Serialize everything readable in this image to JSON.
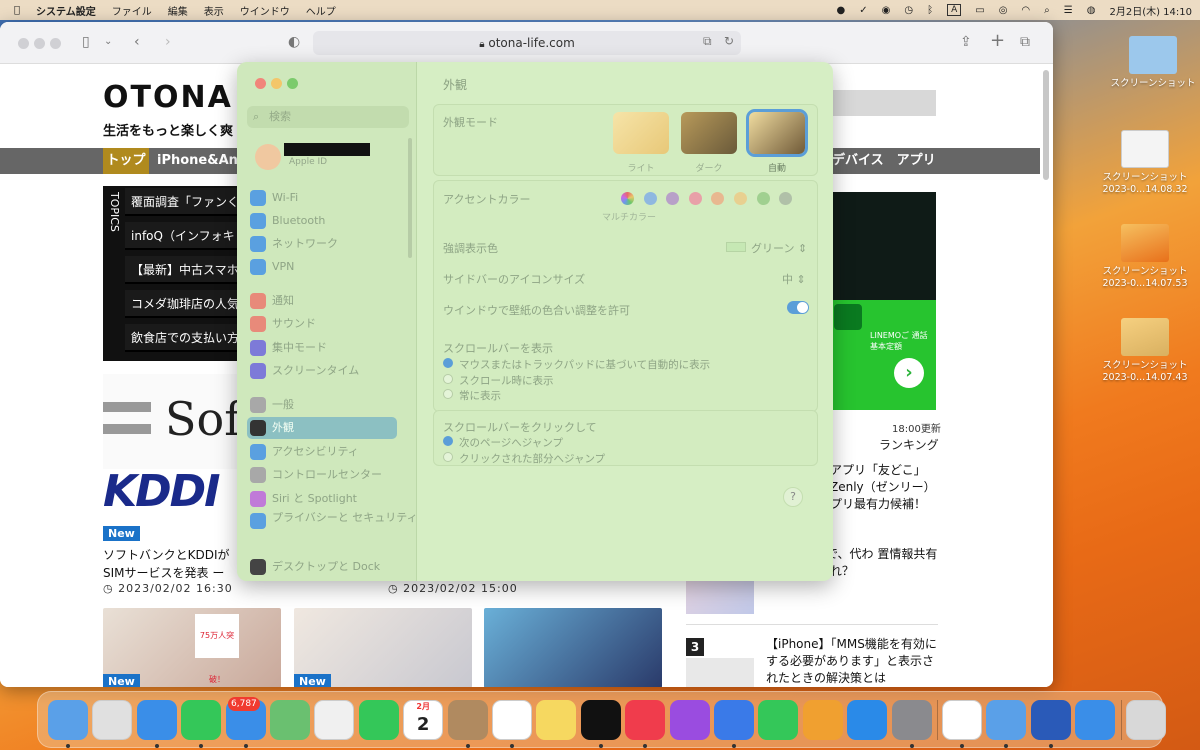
{
  "menubar": {
    "app": "システム設定",
    "items": [
      "ファイル",
      "編集",
      "表示",
      "ウインドウ",
      "ヘルプ"
    ],
    "input_indicator": "A",
    "datetime": "2月2日(木) 14:10"
  },
  "browser": {
    "url": "otona-life.com",
    "page": {
      "logo": "OTONA L",
      "tagline": "生活をもっと楽しく爽",
      "nav_top": "トップ",
      "nav_iphone": "iPhone&And",
      "nav_right": "デバイス　アプリ",
      "topics_label": "TOPICS",
      "topics": [
        "覆面調査「ファンく",
        "infoQ（インフォキ",
        "【最新】中古スマホ",
        "コメダ珈琲店の人気",
        "飲食店での支払い方"
      ],
      "soft_text": "Sof",
      "kddi_text": "KDDI",
      "new_label": "New",
      "article_title": "ソフトバンクとKDDIが SIMサービスを発表 ー",
      "date1": "2023/02/02 16:30",
      "date2": "2023/02/02 15:00",
      "ad_text": "LINEMOご 通話基本定額",
      "update_time": "18:00更新",
      "ranking": "ランキング",
      "rank_items": [
        "アプリ「友どこ」 Zenly（ゼンリー） プリ最有力候補！",
        "リー）終了で、代わ 置情報共有アプリ はどれ？",
        "【iPhone】「MMS機能を有効に する必要があります」と表示さ れたときの解決策とは"
      ],
      "rank_number": "3",
      "thumb_text": "75万人突破！"
    }
  },
  "desktop": {
    "icons": [
      {
        "label": "スクリーンショット"
      },
      {
        "label": "スクリーンショット 2023-0...14.08.32"
      },
      {
        "label": "スクリーンショット 2023-0...14.07.53"
      },
      {
        "label": "スクリーンショット 2023-0...14.07.43"
      }
    ]
  },
  "settings": {
    "search_placeholder": "検索",
    "appleid": "Apple ID",
    "sidebar": [
      {
        "label": "Wi-Fi",
        "icon": "wifi-icon",
        "color": "#5aa0e0"
      },
      {
        "label": "Bluetooth",
        "icon": "bluetooth-icon",
        "color": "#5aa0e0"
      },
      {
        "label": "ネットワーク",
        "icon": "globe-icon",
        "color": "#5aa0e0"
      },
      {
        "label": "VPN",
        "icon": "vpn-icon",
        "color": "#5aa0e0"
      },
      {
        "label": "通知",
        "icon": "bell-icon",
        "color": "#e88a7a"
      },
      {
        "label": "サウンド",
        "icon": "speaker-icon",
        "color": "#e88a7a"
      },
      {
        "label": "集中モード",
        "icon": "moon-icon",
        "color": "#7d7ad8"
      },
      {
        "label": "スクリーンタイム",
        "icon": "hourglass-icon",
        "color": "#7d7ad8"
      },
      {
        "label": "一般",
        "icon": "gear-icon",
        "color": "#a8a8a8"
      },
      {
        "label": "外観",
        "icon": "appearance-icon",
        "color": "#333333"
      },
      {
        "label": "アクセシビリティ",
        "icon": "accessibility-icon",
        "color": "#5aa0e0"
      },
      {
        "label": "コントロールセンター",
        "icon": "control-center-icon",
        "color": "#a8a8a8"
      },
      {
        "label": "Siri と Spotlight",
        "icon": "siri-icon",
        "color": "#c07ad8"
      },
      {
        "label": "プライバシーと セキュリティ",
        "icon": "hand-icon",
        "color": "#5aa0e0"
      },
      {
        "label": "デスクトップと Dock",
        "icon": "dock-icon",
        "color": "#444444"
      }
    ],
    "selected_item": "外観",
    "main": {
      "title": "外観",
      "appearance_mode_label": "外観モード",
      "modes": [
        "ライト",
        "ダーク",
        "自動"
      ],
      "selected_mode": "自動",
      "accent_label": "アクセントカラー",
      "accent_sub": "マルチカラー",
      "accent_colors": [
        "#e0a0c0",
        "#8fb8e0",
        "#b8a0c8",
        "#e8a0a8",
        "#e8b890",
        "#e8d090",
        "#a0d090",
        "#b0c0a8"
      ],
      "highlight_label": "強調表示色",
      "highlight_value": "グリーン",
      "sidebar_icon_label": "サイドバーのアイコンサイズ",
      "sidebar_icon_value": "中",
      "wallpaper_tint_label": "ウインドウで壁紙の色合い調整を許可",
      "wallpaper_tint_on": true,
      "scrollbar_show_label": "スクロールバーを表示",
      "scrollbar_show_options": [
        "マウスまたはトラックパッドに基づいて自動的に表示",
        "スクロール時に表示",
        "常に表示"
      ],
      "scrollbar_click_label": "スクロールバーをクリックして",
      "scrollbar_click_options": [
        "次のページへジャンプ",
        "クリックされた部分へジャンプ"
      ],
      "help": "?"
    }
  },
  "dock": {
    "mail_badge": "6,787",
    "calendar_month": "2月",
    "calendar_day": "2",
    "apps": [
      "Finder",
      "Launchpad",
      "Safari",
      "メッセージ",
      "メール",
      "マップ",
      "写真",
      "FaceTime",
      "カレンダー",
      "連絡先",
      "リマインダー",
      "メモ",
      "TV",
      "ミュージック",
      "Podcast",
      "Keynote",
      "Numbers",
      "Pages",
      "App Store",
      "システム設定",
      "Chrome",
      "プレビュー",
      "Word",
      "Safari",
      "ゴミ箱"
    ]
  }
}
